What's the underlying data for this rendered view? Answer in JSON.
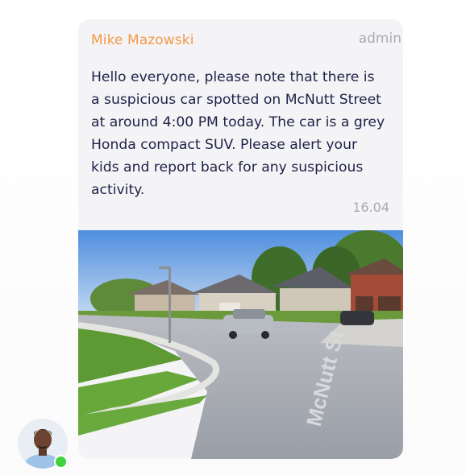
{
  "message": {
    "sender_name": "Mike Mazowski",
    "sender_role": "admin",
    "text": "Hello everyone, please note that there is a suspicious car spotted on McNutt Street at around 4:00 PM today. The car is a grey Honda compact SUV. Please alert your kids and report back for any suspicious activity.",
    "time": "16.04",
    "attachment": {
      "street_marking": "McNutt St"
    }
  },
  "author": {
    "status": "online",
    "status_color": "#3fd23a"
  },
  "colors": {
    "sender": "#f2994a",
    "text": "#1f2148",
    "muted": "#a9a9b8",
    "bubble": "#f4f4f6"
  }
}
